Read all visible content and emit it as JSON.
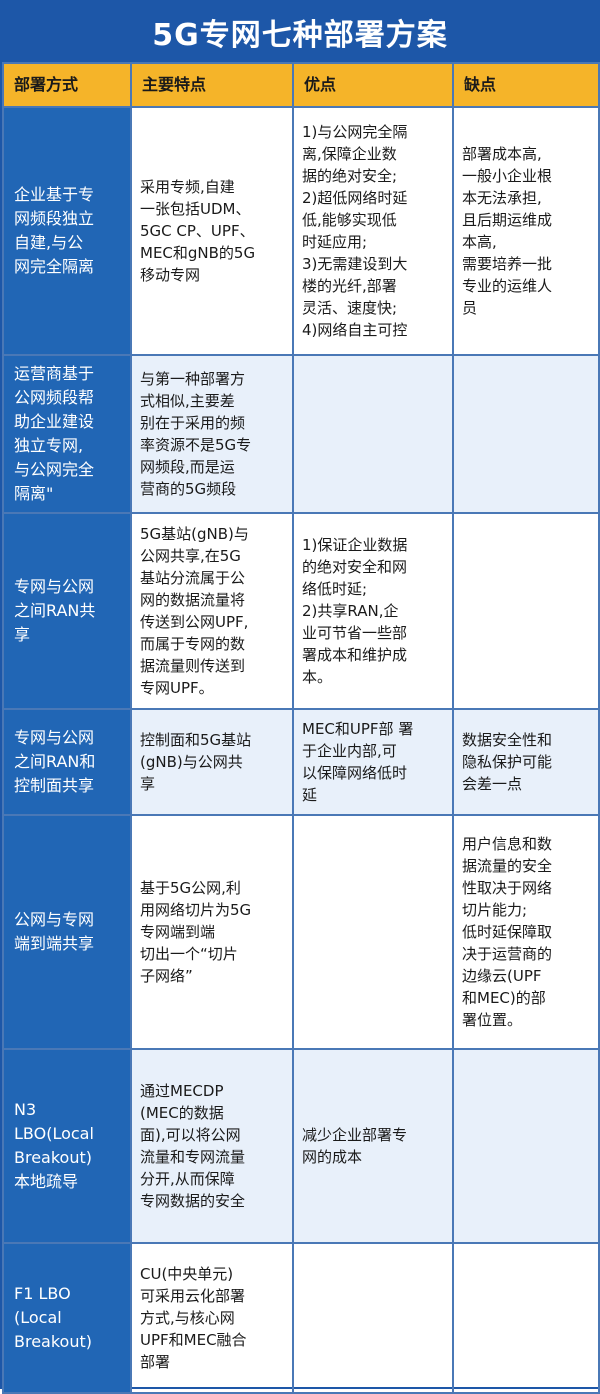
{
  "title": "5G专网七种部署方案",
  "header": {
    "col1": "部署方式",
    "col2": "主要特点",
    "col3": "优点",
    "col4": "缺点"
  },
  "rows": [
    {
      "method": "企业基于专\n网频段独立\n自建,与公\n网完全隔离",
      "features": "采用专频,自建\n一张包括UDM、\n5GC CP、UPF、\nMEC和gNB的5G\n移动专网",
      "pros": "1)与公网完全隔\n离,保障企业数\n据的绝对安全;\n2)超低网络时延\n低,能够实现低\n时延应用;\n3)无需建设到大\n楼的光纤,部署\n灵活、速度快;\n4)网络自主可控",
      "cons": "部署成本高,\n一般小企业根\n本无法承担,\n且后期运维成\n本高,\n需要培养一批\n专业的运维人\n员"
    },
    {
      "method": "运营商基于\n公网频段帮\n助企业建设\n独立专网,\n与公网完全\n隔离\"",
      "features": "与第一种部署方\n式相似,主要差\n别在于采用的频\n率资源不是5G专\n网频段,而是运\n营商的5G频段",
      "pros": "",
      "cons": ""
    },
    {
      "method": "专网与公网\n之间RAN共\n享",
      "features": "5G基站(gNB)与\n公网共享,在5G\n基站分流属于公\n网的数据流量将\n传送到公网UPF,\n而属于专网的数\n据流量则传送到\n专网UPF。",
      "pros": "1)保证企业数据\n的绝对安全和网\n络低时延;\n2)共享RAN,企\n业可节省一些部\n署成本和维护成\n本。",
      "cons": ""
    },
    {
      "method": "专网与公网\n之间RAN和\n控制面共享",
      "features": "控制面和5G基站\n(gNB)与公网共\n享",
      "pros": "MEC和UPF部 署\n于企业内部,可\n以保障网络低时\n延",
      "cons": "数据安全性和\n隐私保护可能\n会差一点"
    },
    {
      "method": "公网与专网\n端到端共享",
      "features": "基于5G公网,利\n用网络切片为5G\n专网端到端\n切出一个“切片\n子网络”",
      "pros": "",
      "cons": "用户信息和数\n据流量的安全\n性取决于网络\n切片能力;\n低时延保障取\n决于运营商的\n边缘云(UPF\n和MEC)的部\n署位置。"
    },
    {
      "method": "N3\nLBO(Local\nBreakout)\n本地疏导",
      "features": "通过MECDP\n(MEC的数据\n面),可以将公网\n流量和专网流量\n分开,从而保障\n专网数据的安全",
      "pros": "减少企业部署专\n网的成本",
      "cons": ""
    },
    {
      "method": "F1 LBO\n(Local\nBreakout)",
      "features": "CU(中央单元)\n可采用云化部署\n方式,与核心网\nUPF和MEC融合\n部署",
      "pros": "",
      "cons": ""
    }
  ]
}
